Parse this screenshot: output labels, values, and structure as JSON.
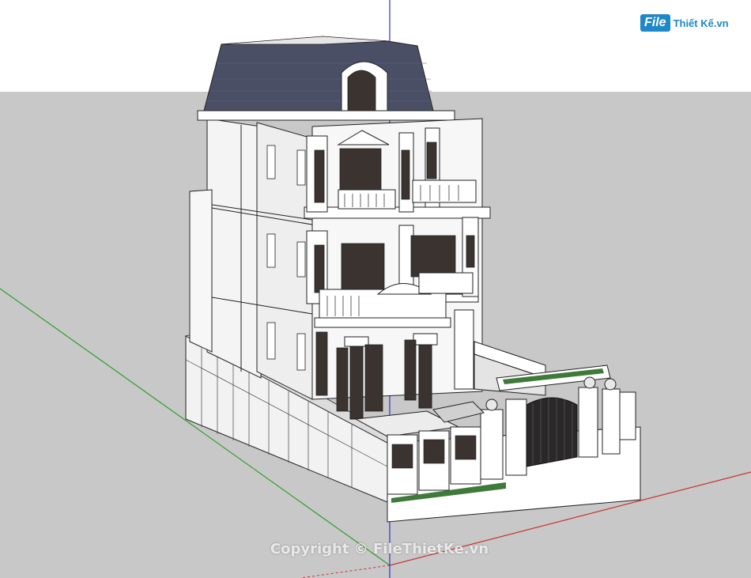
{
  "logo": {
    "badge": "File",
    "text": "Thiết Kế.vn"
  },
  "watermark": {
    "text": "Copyright © FileThietKe.vn"
  },
  "colors": {
    "sky": "#ffffff",
    "ground": "#c8c8c8",
    "wall": "#f0f0f0",
    "roof": "#4a4f66",
    "trim": "#ffffff",
    "window": "#3a3330",
    "axis_green": "#2e9e2e",
    "axis_red": "#c83232",
    "axis_blue": "#3232c8",
    "grass": "#3f7a3a"
  }
}
